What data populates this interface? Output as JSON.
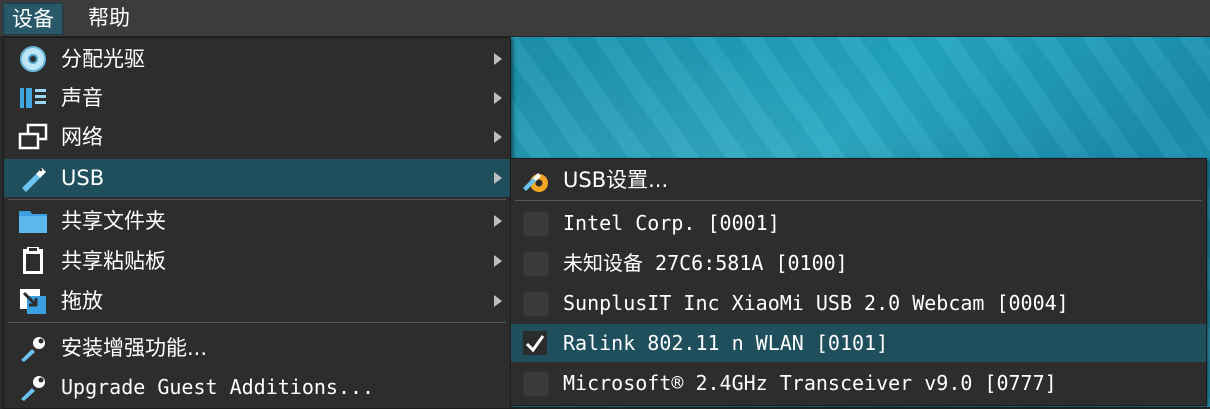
{
  "menubar": {
    "devices": "设备",
    "help": "帮助"
  },
  "devices_menu": {
    "items": [
      {
        "label": "分配光驱",
        "icon": "optical-disc-icon"
      },
      {
        "label": "声音",
        "icon": "audio-icon"
      },
      {
        "label": "网络",
        "icon": "network-icon"
      },
      {
        "label": "USB",
        "icon": "usb-icon"
      },
      {
        "label": "共享文件夹",
        "icon": "shared-folder-icon"
      },
      {
        "label": "共享粘贴板",
        "icon": "clipboard-icon"
      },
      {
        "label": "拖放",
        "icon": "drag-drop-icon"
      },
      {
        "label": "安装增强功能...",
        "icon": "guest-additions-icon"
      },
      {
        "label": "Upgrade Guest Additions...",
        "icon": "guest-additions-icon"
      }
    ]
  },
  "usb_menu": {
    "settings_label": "USB设置...",
    "devices": [
      {
        "label": "Intel Corp.  [0001]",
        "checked": false
      },
      {
        "label": "未知设备 27C6:581A [0100]",
        "checked": false
      },
      {
        "label": "SunplusIT Inc XiaoMi USB 2.0 Webcam [0004]",
        "checked": false
      },
      {
        "label": "Ralink 802.11 n WLAN [0101]",
        "checked": true
      },
      {
        "label": "Microsoft® 2.4GHz Transceiver v9.0 [0777]",
        "checked": false
      }
    ]
  },
  "colors": {
    "highlight": "#1f4e5d",
    "menu_bg": "#2d2d2d",
    "desktop": "#1d93ad"
  }
}
